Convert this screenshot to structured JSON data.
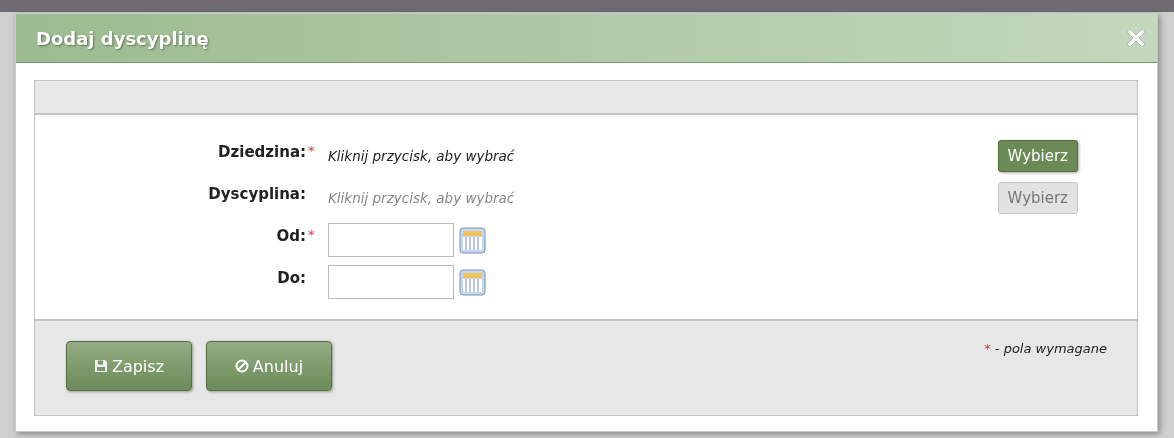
{
  "dialog": {
    "title": "Dodaj dyscyplinę",
    "fields": [
      {
        "kind": "picker",
        "label": "Dziedzina:",
        "mark": "*",
        "value": "Kliknij przycisk, aby wybrać",
        "button": "Wybierz",
        "disabled": false
      },
      {
        "kind": "picker",
        "label": "Dyscyplina:",
        "value": "Kliknij przycisk, aby wybrać",
        "button": "Wybierz",
        "disabled": true
      },
      {
        "kind": "date",
        "label": "Od:",
        "mark": "*"
      },
      {
        "kind": "date",
        "label": "Do:"
      }
    ],
    "buttons": [
      {
        "kind": "save",
        "label": "Zapisz"
      },
      {
        "kind": "cancel",
        "label": "Anuluj"
      }
    ],
    "legend": {
      "mark": "*",
      "text": "- pola wymagane"
    }
  }
}
